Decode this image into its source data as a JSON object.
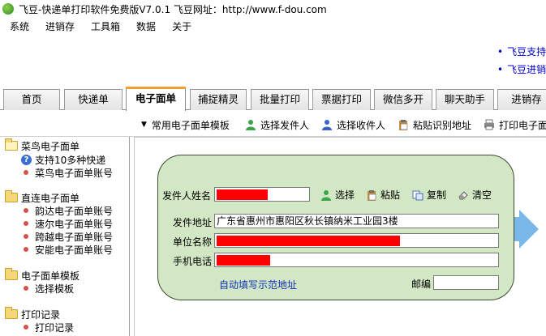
{
  "window": {
    "title": "飞豆-快递单打印软件免费版V7.0.1   飞豆网址：http://www.f-dou.com"
  },
  "menu": [
    "系统",
    "进销存",
    "工具箱",
    "数据",
    "关于"
  ],
  "ads": [
    "飞豆支持",
    "飞豆进销"
  ],
  "tabs": [
    "首页",
    "快递单",
    "电子面单",
    "捕捉精灵",
    "批量打印",
    "票据打印",
    "微信多开",
    "聊天助手",
    "进销存"
  ],
  "active_tab": "电子面单",
  "toolbar": {
    "template": "常用电子面单模板",
    "select_sender": "选择发件人",
    "select_receiver": "选择收件人",
    "paste_recognize": "粘贴识别地址",
    "print": "打印电子面"
  },
  "tree": {
    "cainiao": {
      "title": "菜鸟电子面单",
      "items": [
        "支持10多种快递",
        "菜鸟电子面单账号"
      ]
    },
    "direct": {
      "title": "直连电子面单",
      "items": [
        "韵达电子面单账号",
        "速尔电子面单账号",
        "跨越电子面单账号",
        "安能电子面单账号"
      ]
    },
    "templates": {
      "title": "电子面单模板",
      "items": [
        "选择模板"
      ]
    },
    "print_log": {
      "title": "打印记录",
      "items": [
        "打印记录"
      ]
    }
  },
  "form": {
    "sender_name_label": "发件人姓名",
    "select": "选择",
    "paste": "粘贴",
    "copy": "复制",
    "clear": "清空",
    "address_label": "发件地址",
    "address_value": "广东省惠州市惠阳区秋长镇纳米工业园3楼",
    "company_label": "单位名称",
    "phone_label": "手机电话",
    "autofill_link": "自动填写示范地址",
    "postcode_label": "邮编",
    "postcode_value": ""
  },
  "colors": {
    "redaction": "#ff0000",
    "panel": "#d2e7c3",
    "link": "#1030c0",
    "tab_accent": "#f0a030"
  }
}
